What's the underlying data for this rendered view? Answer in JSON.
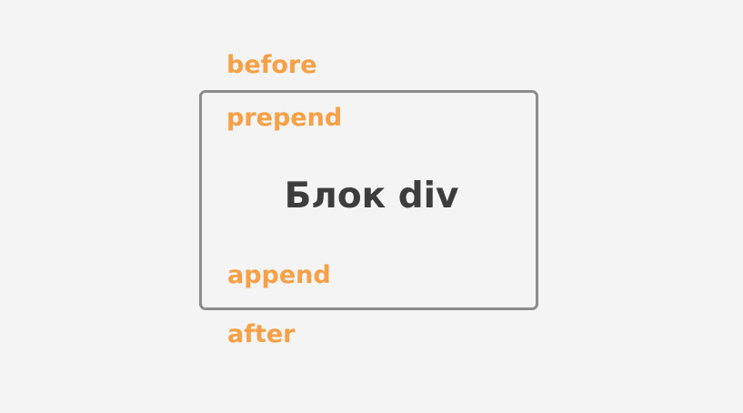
{
  "labels": {
    "before": "before",
    "prepend": "prepend",
    "append": "append",
    "after": "after"
  },
  "box": {
    "title": "Блок div"
  },
  "colors": {
    "label": "#f7a046",
    "title": "#3d3d3d",
    "border": "#8c8c8c",
    "background": "#f4f4f4"
  }
}
